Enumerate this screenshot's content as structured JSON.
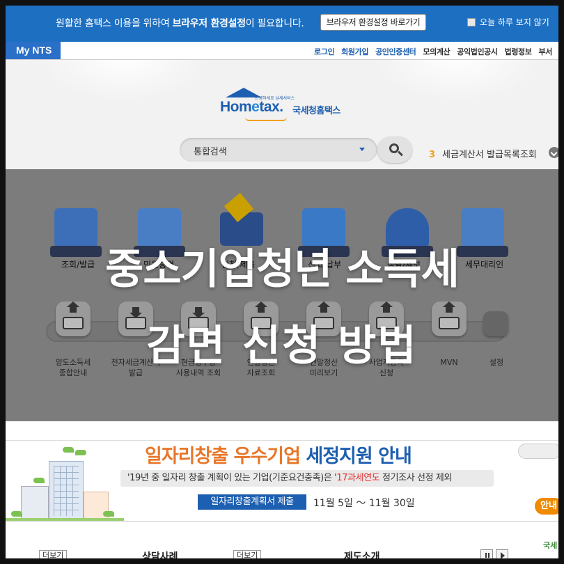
{
  "notice": {
    "message_pre": "원활한 홈택스 이용을 위하여 ",
    "message_bold": "브라우저 환경설정",
    "message_post": "이 필요합니다.",
    "button": "브라우저 환경설정 바로가기",
    "checkbox_label": "오늘 하루 보지 않기"
  },
  "util_nav": {
    "my_nts": "My NTS",
    "links": [
      "로그인",
      "회원가입",
      "공인인증센터",
      "모의계산",
      "공익법인공시",
      "법령정보",
      "부서"
    ]
  },
  "logo": {
    "tagline": "안녕하세요 납세서비스",
    "home_pre": "Hom",
    "home_e": "e",
    "home_post": "tax.",
    "korean": "국세청홈택스"
  },
  "search": {
    "placeholder": "통합검색",
    "ranking_number": "3",
    "ranking_text": "세금계산서 발급목록조회"
  },
  "big_menu": [
    "조회/발급",
    "민원증명",
    "신청/제출",
    "신고/납부",
    "상담/제보",
    "세무대리인"
  ],
  "small_menu": [
    {
      "line1": "양도소득세",
      "line2": "종합안내",
      "icon": "house-icon"
    },
    {
      "line1": "전자세금계산서",
      "line2": "발급",
      "icon": "download-icon"
    },
    {
      "line1": "현금영수증",
      "line2": "사용내역 조회",
      "icon": "money-icon"
    },
    {
      "line1": "연말정산",
      "line2": "자료조회",
      "icon": "won-icon"
    },
    {
      "line1": "연말정산",
      "line2": "미리보기",
      "icon": "won-upload-icon"
    },
    {
      "line1": "사업자등록",
      "line2": "신청",
      "icon": "upload-icon"
    },
    {
      "line1": "MVN",
      "line2": "",
      "icon": "upload-icon"
    },
    {
      "line1": "설정",
      "line2": "",
      "icon": "plus-icon"
    }
  ],
  "overlay": {
    "line1": "중소기업청년 소득세",
    "line2": "감면 신청 방법"
  },
  "banner": {
    "title_orange": "일자리창출 우수기업 ",
    "title_blue": "세정지원 안내",
    "sub_pre": "'19년 중 일자리 창출 계획이 있는 기업(기준요건충족)은 '",
    "sub_red": "17과세연도",
    "sub_post": " 정기조사 선정 제외",
    "pill": "일자리창출계획서 제출",
    "dates": "11월 5일 ～ 11월 30일",
    "info": "안내"
  },
  "bottom": {
    "more1": "더보기",
    "head1": "상담사례",
    "more2": "더보기",
    "head2": "제도소개",
    "corner": "국세"
  },
  "colors": {
    "brand_blue": "#1d6fc1",
    "accent_orange": "#e8772a",
    "highlight_red": "#e03030"
  }
}
